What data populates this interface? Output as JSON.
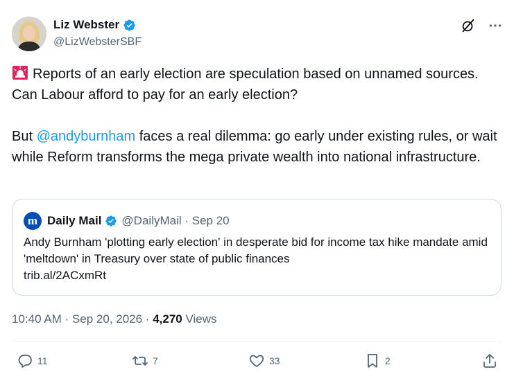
{
  "author": {
    "name": "Liz Webster",
    "handle": "@LizWebsterSBF"
  },
  "tweet": {
    "paragraph1": "Reports of an early election are speculation based on unnamed sources. Can Labour afford to pay for an early election?",
    "para2_before": "But ",
    "mention": "@andyburnham",
    "para2_after": " faces a real dilemma: go early under existing rules, or wait while Reform transforms the mega private wealth into national infrastructure.",
    "emoji": "rotating-light-icon"
  },
  "quote": {
    "logo_letter": "m",
    "name": "Daily Mail",
    "meta": "@DailyMail · Sep 20",
    "text": "Andy Burnham 'plotting early election' in desperate bid for income tax hike mandate amid 'meltdown' in Treasury over state of public finances",
    "link": "trib.al/2ACxmRt"
  },
  "meta": {
    "time": "10:40 AM · Sep 20, 2026 · ",
    "views_count": "4,270",
    "views_label": " Views"
  },
  "actions": {
    "replies": "11",
    "reposts": "7",
    "likes": "33",
    "bookmarks": "2"
  },
  "colors": {
    "accent": "#1d9bf0",
    "muted": "#536471",
    "verified": "#1d9bf0",
    "daily_mail": "#004db3",
    "siren": "#e0245e"
  }
}
